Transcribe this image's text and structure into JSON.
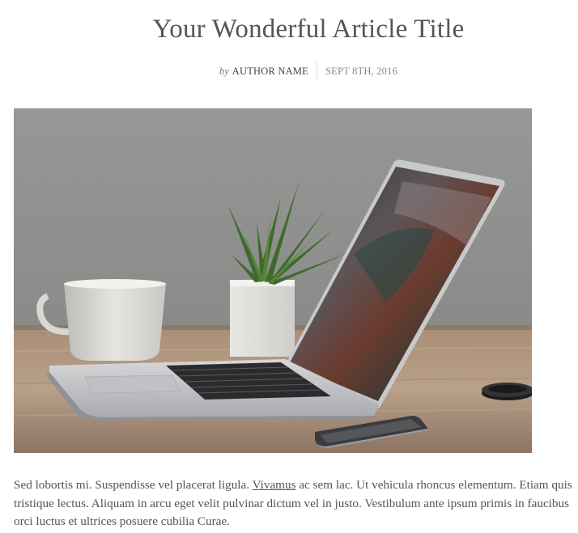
{
  "article": {
    "title": "Your Wonderful Article Title",
    "by_label": "by",
    "author": "AUTHOR NAME",
    "date": "SEPT 8TH, 2016",
    "hero_image": "laptop-on-desk-photo",
    "body": {
      "before_link": "Sed lobortis mi. Suspendisse vel placerat ligula. ",
      "link_text": "Vivamus",
      "after_link": " ac sem lac. Ut vehicula rhoncus elementum. Etiam quis tristique lectus. Aliquam in arcu eget velit pulvinar dictum vel in justo. Vestibulum ante ipsum primis in faucibus orci luctus et ultrices posuere cubilia Curae."
    }
  }
}
